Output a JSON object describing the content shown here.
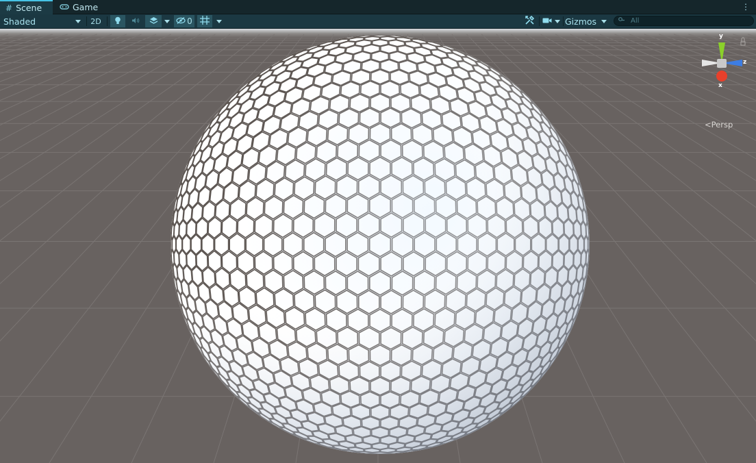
{
  "tabs": [
    {
      "label": "Scene",
      "icon": "scene-grid-icon",
      "active": true
    },
    {
      "label": "Game",
      "icon": "gamepad-icon",
      "active": false
    }
  ],
  "toolbar": {
    "draw_mode": "Shaded",
    "mode_2d": "2D",
    "hidden_count": "0",
    "gizmos": "Gizmos",
    "search_placeholder": "All",
    "icons": [
      "light-bulb-icon",
      "audio-icon",
      "effects-icon",
      "visibility-icon",
      "grid-icon",
      "tools-icon",
      "camera-icon",
      "search-icon",
      "overflow-menu-icon"
    ]
  },
  "scene": {
    "object": "hexagon-tiled-sphere",
    "floor_color": "#686260",
    "sphere_color": "#f3f6fa"
  },
  "gizmo": {
    "axes": [
      "y",
      "z",
      "x"
    ],
    "colors": {
      "y": "#8bd12a",
      "z": "#3d7de3",
      "x": "#e8402b",
      "neg": "#e6e6e6"
    },
    "projection": "Persp"
  }
}
